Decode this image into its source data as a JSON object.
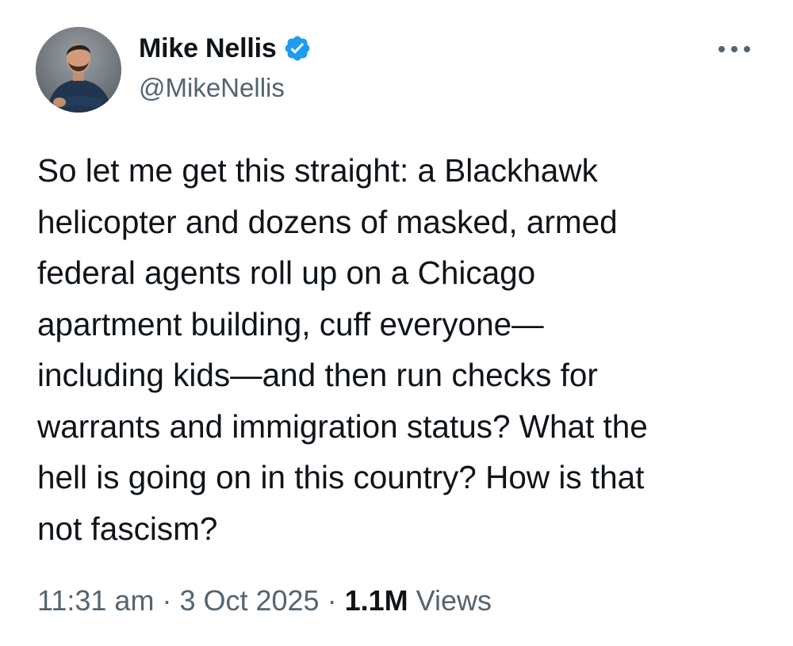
{
  "tweet": {
    "author": {
      "display_name": "Mike Nellis",
      "handle": "@MikeNellis",
      "verified_icon": "verified-badge-icon",
      "verified_color": "#1d9bf0"
    },
    "text": "So let me get this straight: a Blackhawk\nhelicopter and dozens of masked, armed\nfederal agents roll up on a Chicago\napartment building, cuff everyone—\nincluding kids—and then run checks for\nwarrants and immigration status? What the\nhell is going on in this country? How is that\nnot fascism?",
    "meta": {
      "time": "11:31 am",
      "separator": "·",
      "date": "3 Oct 2025",
      "views_count": "1.1M",
      "views_label": "Views"
    },
    "more_icon": "more-horizontal-icon"
  },
  "colors": {
    "text_primary": "#0f1419",
    "text_secondary": "#536471",
    "accent": "#1d9bf0",
    "background": "#ffffff"
  }
}
